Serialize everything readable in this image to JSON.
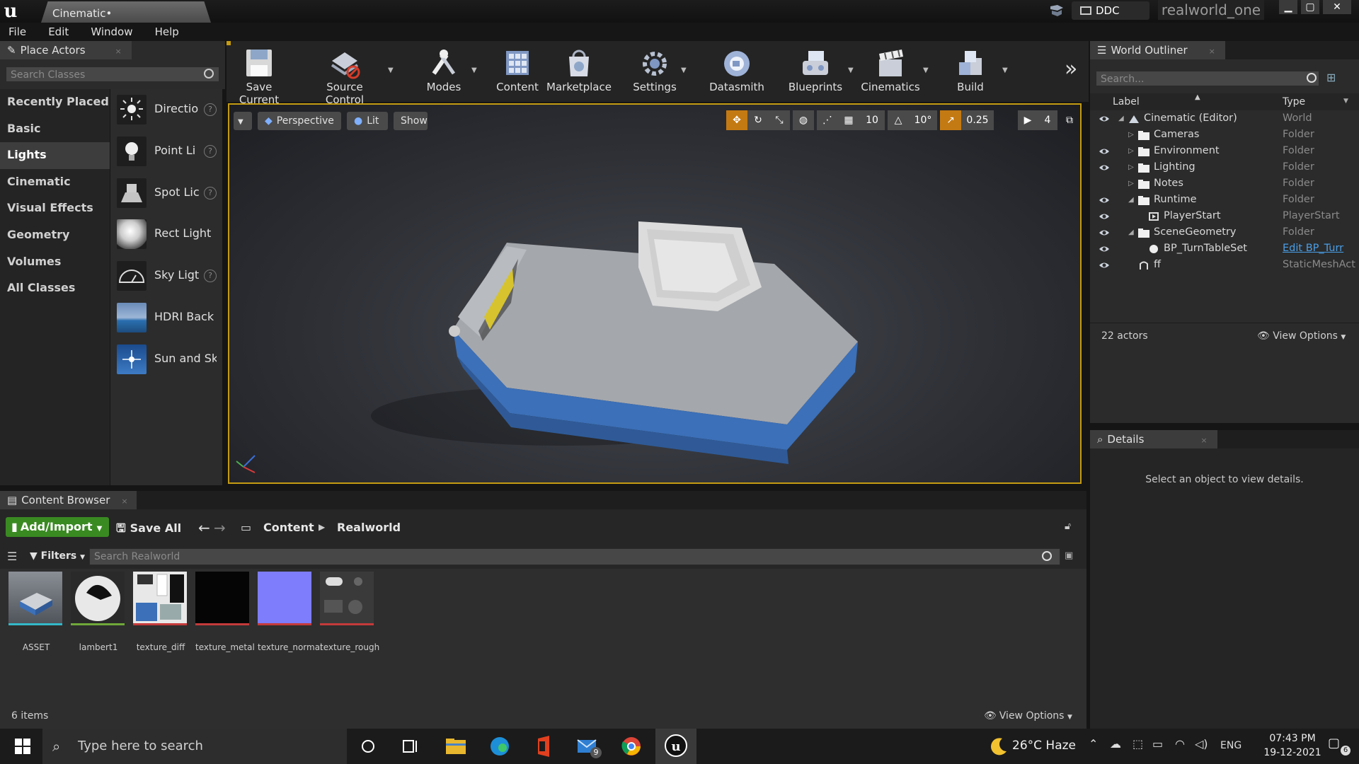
{
  "window": {
    "tab_title": "Cinematic•",
    "ddc_label": "DDC",
    "project_name": "realworld_one",
    "min": "▁",
    "max": "▢",
    "close": "✕"
  },
  "menubar": [
    "File",
    "Edit",
    "Window",
    "Help"
  ],
  "place_actors": {
    "tab": "Place Actors",
    "search_placeholder": "Search Classes",
    "categories": [
      "Recently Placed",
      "Basic",
      "Lights",
      "Cinematic",
      "Visual Effects",
      "Geometry",
      "Volumes",
      "All Classes"
    ],
    "selected_category": "Lights",
    "items": [
      {
        "label": "Directio",
        "icon": "directional-light-icon"
      },
      {
        "label": "Point Li",
        "icon": "point-light-icon"
      },
      {
        "label": "Spot Lic",
        "icon": "spot-light-icon"
      },
      {
        "label": "Rect Light",
        "icon": "rect-light-icon"
      },
      {
        "label": "Sky Ligt",
        "icon": "sky-light-icon"
      },
      {
        "label": "HDRI Back",
        "icon": "hdri-backdrop-icon"
      },
      {
        "label": "Sun and Sk",
        "icon": "sun-and-sky-icon"
      }
    ]
  },
  "toolbar": {
    "items": [
      {
        "label": "Save Current",
        "icon": "save-icon"
      },
      {
        "label": "Source Control",
        "icon": "source-control-icon"
      },
      {
        "label": "Modes",
        "icon": "modes-icon"
      },
      {
        "label": "Content",
        "icon": "content-icon"
      },
      {
        "label": "Marketplace",
        "icon": "marketplace-icon"
      },
      {
        "label": "Settings",
        "icon": "settings-icon"
      },
      {
        "label": "Datasmith",
        "icon": "datasmith-icon"
      },
      {
        "label": "Blueprints",
        "icon": "blueprints-icon"
      },
      {
        "label": "Cinematics",
        "icon": "cinematics-icon"
      },
      {
        "label": "Build",
        "icon": "build-icon"
      }
    ],
    "more": "»"
  },
  "viewport": {
    "perspective": "Perspective",
    "lit": "Lit",
    "show": "Show",
    "grid_snap": "10",
    "rot_snap": "10°",
    "scale_snap": "0.25",
    "cam_speed": "4"
  },
  "content_browser": {
    "tab": "Content Browser",
    "add_import": "Add/Import",
    "save_all": "Save All",
    "path": [
      "Content",
      "Realworld"
    ],
    "filters": "Filters",
    "search_placeholder": "Search Realworld",
    "assets": [
      {
        "name": "ASSET",
        "color": "#33b8c8"
      },
      {
        "name": "lambert1",
        "color": "#6fa83a"
      },
      {
        "name": "texture_diff",
        "color": "#c43a3a"
      },
      {
        "name": "texture_metal",
        "color": "#c43a3a"
      },
      {
        "name": "texture_normal",
        "color": "#c43a3a"
      },
      {
        "name": "texture_rough",
        "color": "#c43a3a"
      }
    ],
    "item_count": "6 items",
    "view_options": "View Options"
  },
  "world_outliner": {
    "tab": "World Outliner",
    "search_placeholder": "Search...",
    "col_label": "Label",
    "col_type": "Type",
    "rows": [
      {
        "label": "Cinematic (Editor)",
        "type": "World"
      },
      {
        "label": "Cameras",
        "type": "Folder"
      },
      {
        "label": "Environment",
        "type": "Folder"
      },
      {
        "label": "Lighting",
        "type": "Folder"
      },
      {
        "label": "Notes",
        "type": "Folder"
      },
      {
        "label": "Runtime",
        "type": "Folder"
      },
      {
        "label": "PlayerStart",
        "type": "PlayerStart"
      },
      {
        "label": "SceneGeometry",
        "type": "Folder"
      },
      {
        "label": "BP_TurnTableSet",
        "type": "Edit BP_Turr"
      },
      {
        "label": "ff",
        "type": "StaticMeshAct"
      }
    ],
    "actor_count": "22 actors",
    "view_options": "View Options"
  },
  "details": {
    "tab": "Details",
    "empty": "Select an object to view details."
  },
  "taskbar": {
    "search_placeholder": "Type here to search",
    "mail_badge": "9",
    "weather": "26°C  Haze",
    "lang": "ENG",
    "time": "07:43 PM",
    "date": "19-12-2021",
    "notif_badge": "6"
  }
}
